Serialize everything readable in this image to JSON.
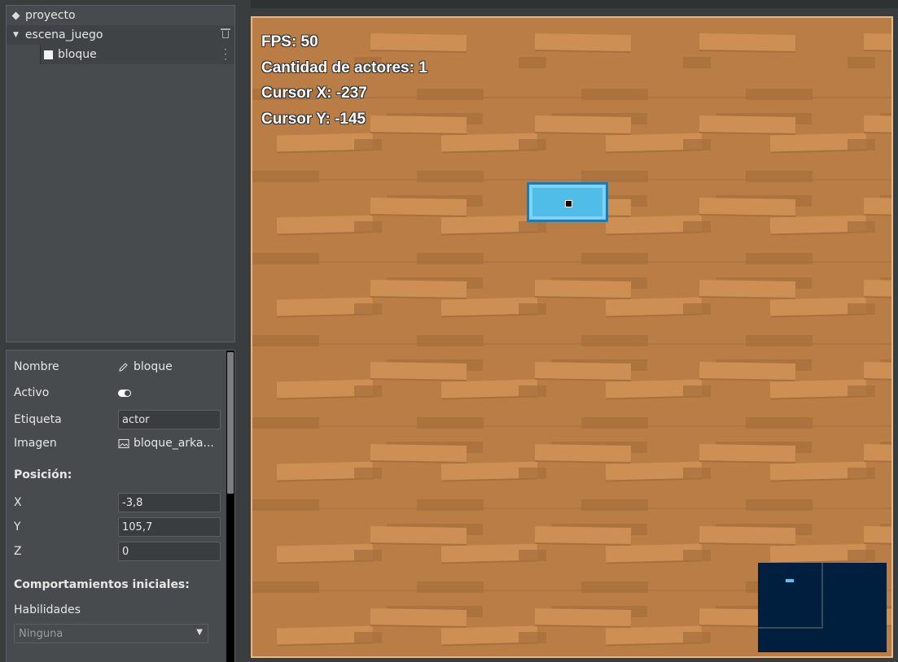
{
  "tree": {
    "project": "proyecto",
    "scene": "escena_juego",
    "actor": "bloque"
  },
  "properties": {
    "name_label": "Nombre",
    "name_value": "bloque",
    "active_label": "Activo",
    "active_value": true,
    "tag_label": "Etiqueta",
    "tag_value": "actor",
    "image_label": "Imagen",
    "image_value": "bloque_arka...",
    "position_heading": "Posición:",
    "x_label": "X",
    "x_value": "-3,8",
    "y_label": "Y",
    "y_value": "105,7",
    "z_label": "Z",
    "z_value": "0",
    "behaviors_heading": "Comportamientos iniciales:",
    "skills_label": "Habilidades",
    "skills_value": "Ninguna"
  },
  "hud": {
    "fps": "FPS: 50",
    "actors": "Cantidad de actores: 1",
    "cursor_x": "Cursor X: -237",
    "cursor_y": "Cursor Y: -145"
  },
  "icons": {
    "project": "diamond-icon",
    "scene": "caret-down-icon",
    "delete": "trash-icon",
    "actor": "square-icon",
    "menu": "more-vertical-icon",
    "edit": "pencil-icon",
    "image": "image-icon",
    "dropdown": "chevron-down-icon"
  },
  "colors": {
    "panel": "#474b4d",
    "background": "#3a3d3e",
    "floor": "#b97d45",
    "block": "#4fbde8",
    "minimap": "#001f3f"
  }
}
